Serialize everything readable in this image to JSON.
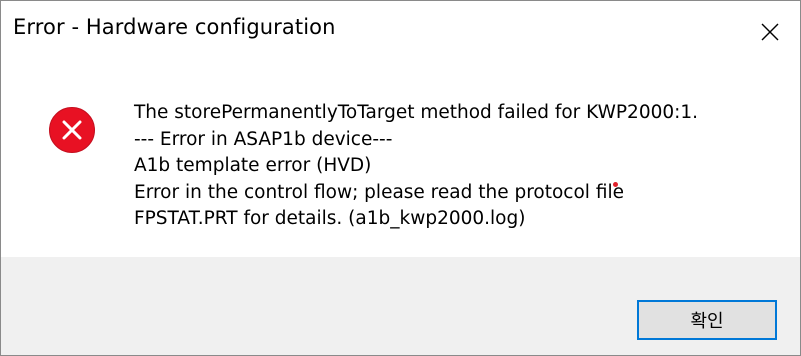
{
  "window": {
    "title": "Error - Hardware configuration",
    "close_icon": "close-icon"
  },
  "message": {
    "icon": "error-icon",
    "accent_color": "#e81123",
    "lines": [
      "The storePermanentlyToTarget method failed for KWP2000:1.",
      "--- Error in ASAP1b device---",
      "A1b template error (HVD)",
      "Error in the control flow; please read the protocol file",
      "FPSTAT.PRT for details. (a1b_kwp2000.log)"
    ]
  },
  "footer": {
    "ok_label": "확인",
    "focus_color": "#0078d7"
  }
}
